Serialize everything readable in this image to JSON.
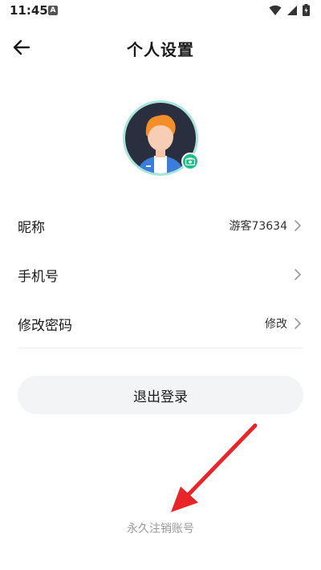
{
  "status_bar": {
    "time": "11:45",
    "app_icon_letter": "A",
    "icons": [
      "wifi-icon",
      "cell-signal-icon",
      "battery-icon"
    ]
  },
  "header": {
    "back_icon": "arrow-left-icon",
    "title": "个人设置"
  },
  "avatar": {
    "camera_icon": "camera-icon",
    "accent_color": "#1ec18a"
  },
  "rows": [
    {
      "label": "昵称",
      "value": "游客73634"
    },
    {
      "label": "手机号",
      "value": ""
    },
    {
      "label": "修改密码",
      "value": "修改"
    }
  ],
  "logout_label": "退出登录",
  "deactivate_label": "永久注销账号",
  "annotation": {
    "arrow_color": "#e8262a"
  }
}
